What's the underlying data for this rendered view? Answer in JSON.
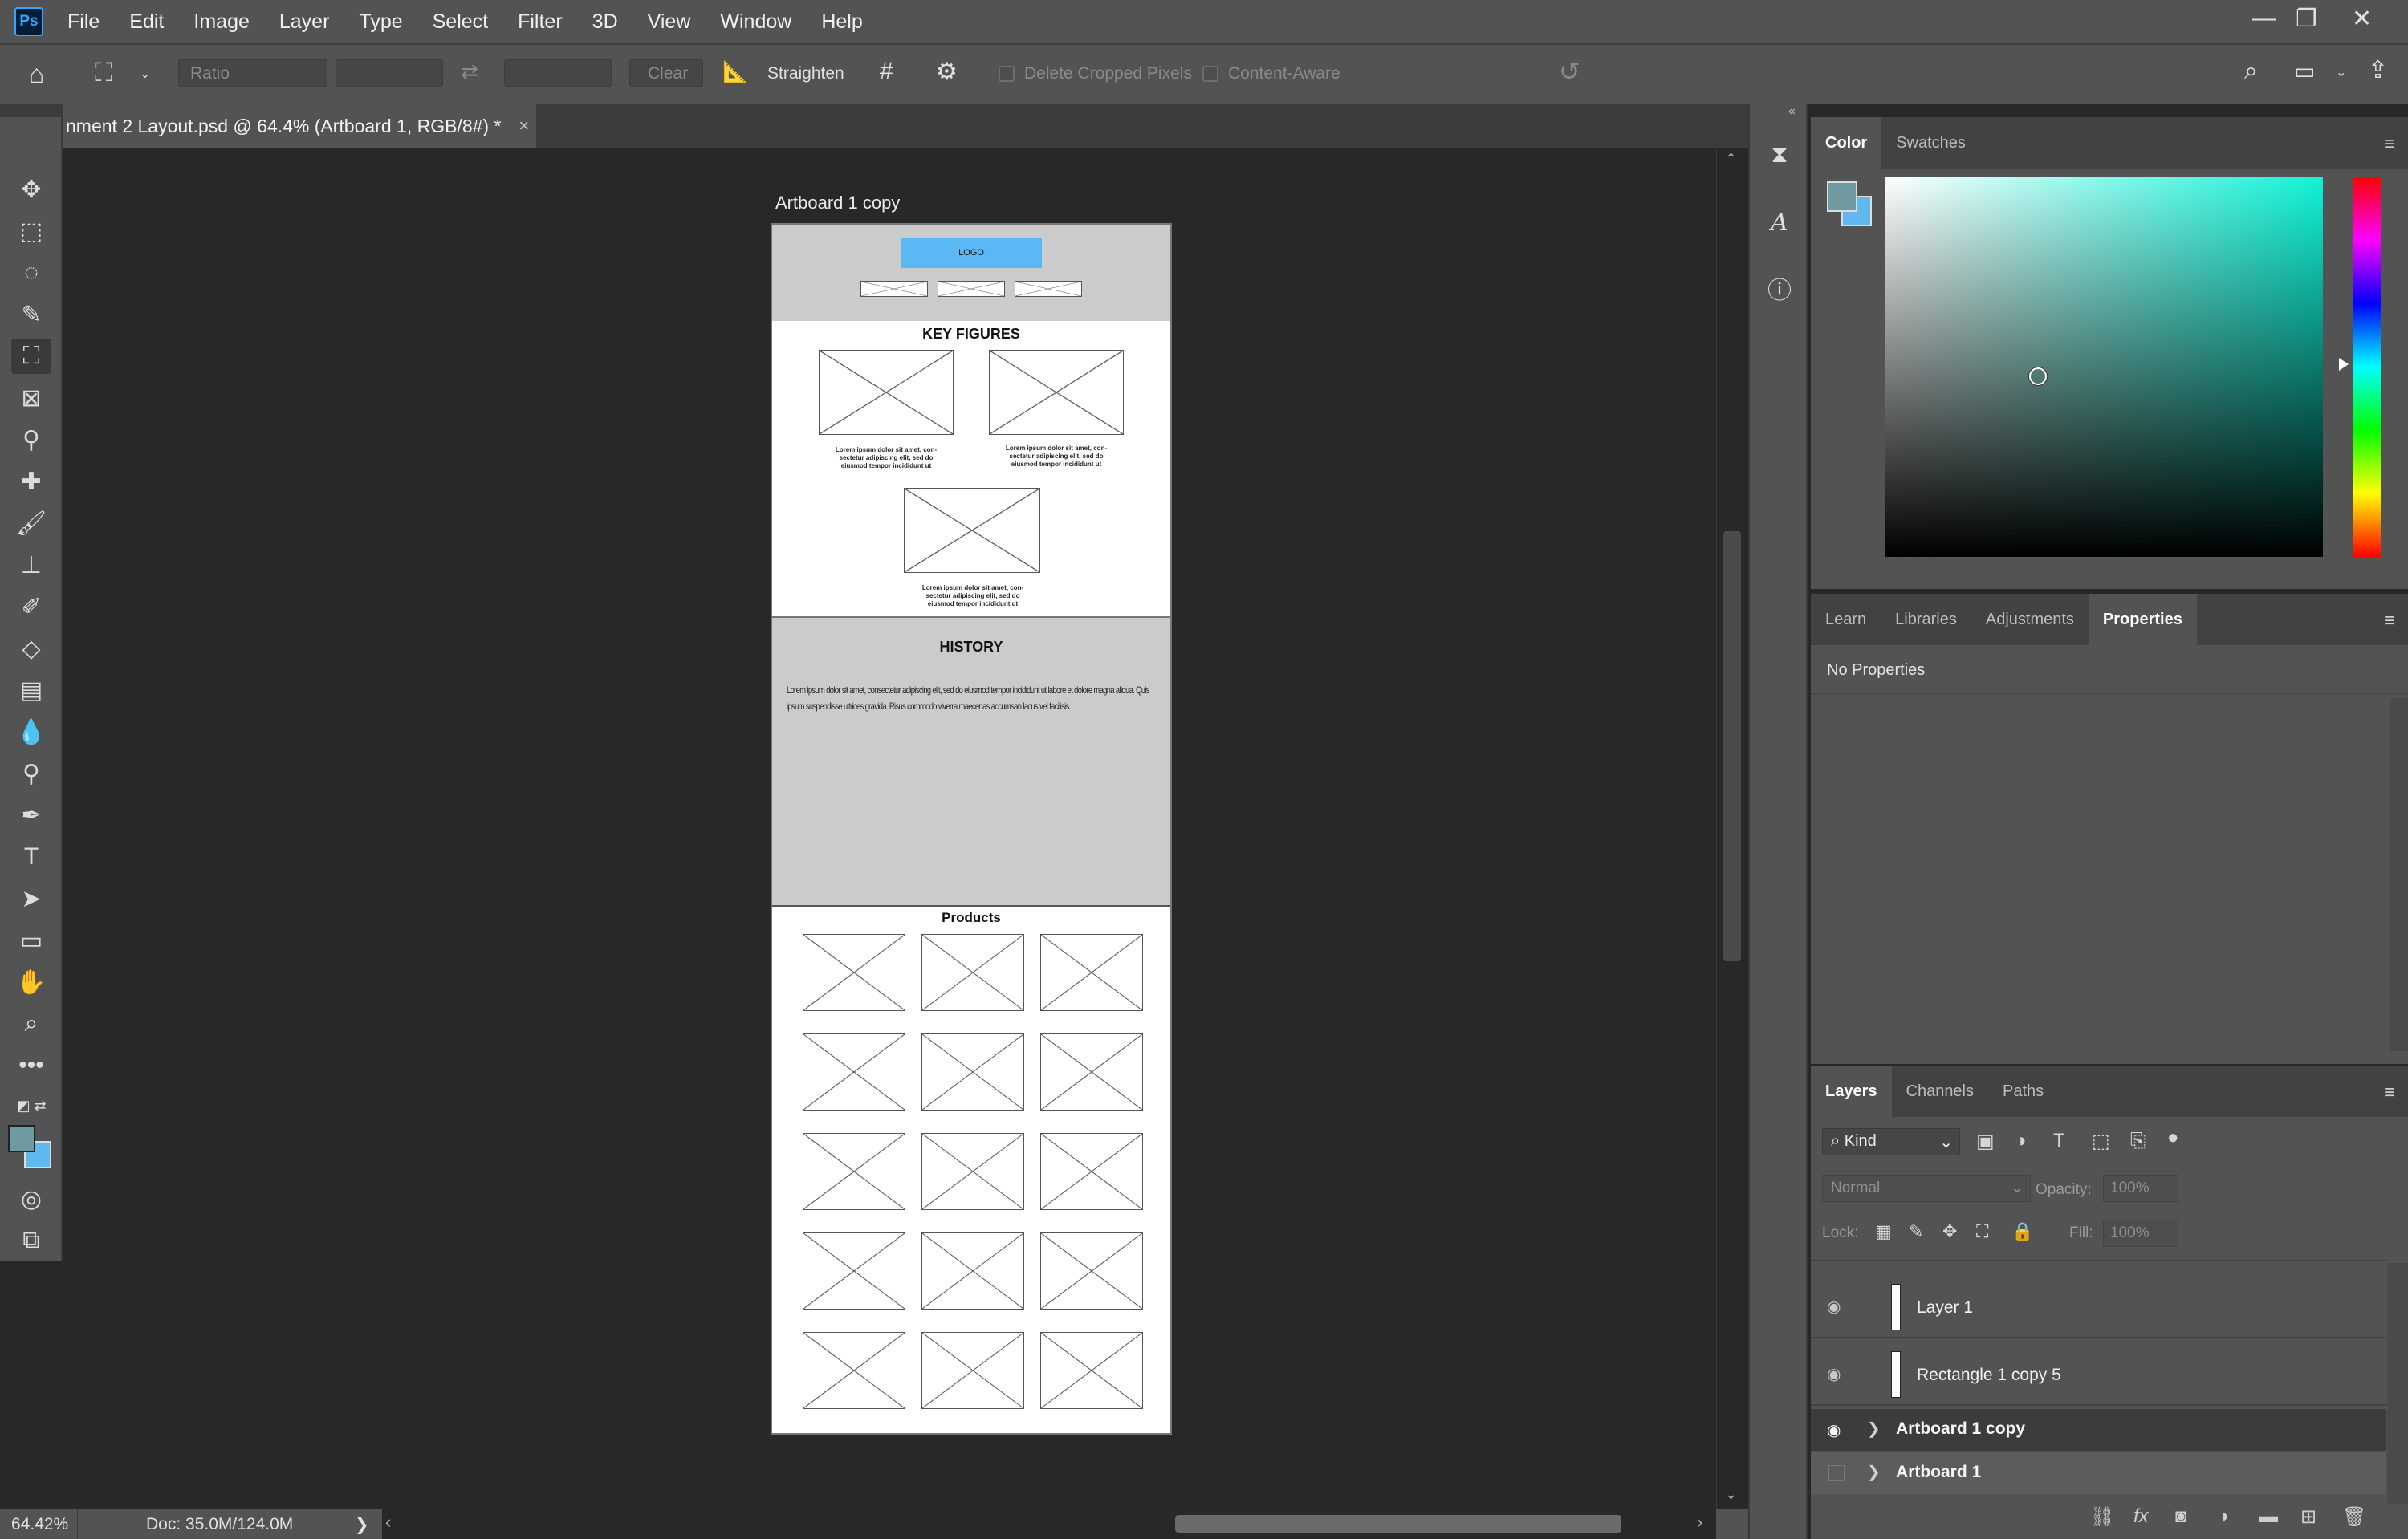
{
  "app": {
    "logo": "Ps"
  },
  "menu": [
    "File",
    "Edit",
    "Image",
    "Layer",
    "Type",
    "Select",
    "Filter",
    "3D",
    "View",
    "Window",
    "Help"
  ],
  "window_controls": {
    "minimize": "—",
    "restore": "❐",
    "close": "✕"
  },
  "options": {
    "ratio_label": "Ratio",
    "clear_label": "Clear",
    "straighten_label": "Straighten",
    "delete_cropped_label": "Delete Cropped Pixels",
    "content_aware_label": "Content-Aware"
  },
  "document": {
    "tab_title": "nment 2 Layout.psd @ 64.4% (Artboard 1, RGB/8#) *",
    "tab_close": "×",
    "collapse": "»",
    "close": "×"
  },
  "artboard": {
    "label": "Artboard 1 copy",
    "logo_text": "LOGO",
    "key_figures_heading": "KEY FIGURES",
    "key_caption": "Lorem ipsum dolor sit amet, con-\nsectetur adipiscing elit, sed do\neiusmod tempor incididunt ut",
    "history_heading": "HISTORY",
    "history_text": "Lorem ipsum dolor sit amet, consectetur adipiscing elit, sed do eiusmod tempor incididunt ut labore et dolore magna aliqua. Quis ipsum suspendisse ultrices gravida. Risus commodo viverra maecenas accumsan lacus vel facilisis.",
    "products_heading": "Products"
  },
  "status": {
    "zoom": "64.42%",
    "doc": "Doc: 35.0M/124.0M",
    "arrow": "❯"
  },
  "color_panel": {
    "tabs": [
      "Color",
      "Swatches"
    ],
    "active_tab": "Color",
    "foreground": "#6f9aa0",
    "background": "#5fb9ef"
  },
  "props_panel": {
    "tabs": [
      "Learn",
      "Libraries",
      "Adjustments",
      "Properties"
    ],
    "active_tab": "Properties",
    "empty_text": "No Properties"
  },
  "layers_panel": {
    "tabs": [
      "Layers",
      "Channels",
      "Paths"
    ],
    "active_tab": "Layers",
    "filter_kind": "Kind",
    "blend_mode": "Normal",
    "opacity_label": "Opacity:",
    "opacity_value": "100%",
    "lock_label": "Lock:",
    "fill_label": "Fill:",
    "fill_value": "100%",
    "layers": [
      {
        "name": "Layer 1"
      },
      {
        "name": "Rectangle 1 copy 5"
      }
    ],
    "artboards": [
      {
        "name": "Artboard 1 copy"
      },
      {
        "name": "Artboard 1"
      }
    ]
  }
}
